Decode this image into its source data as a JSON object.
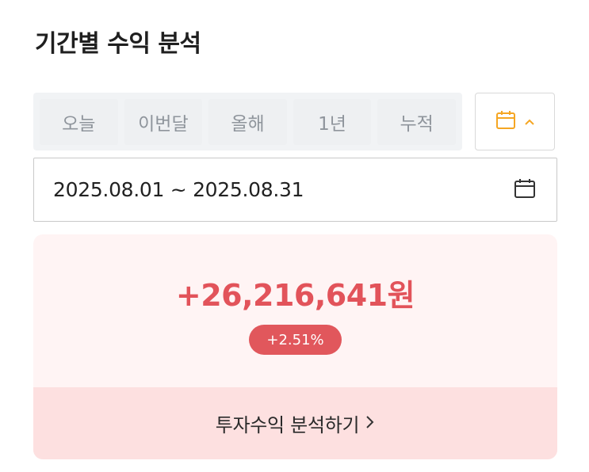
{
  "header": {
    "title": "기간별 수익 분석"
  },
  "period_tabs": [
    {
      "label": "오늘"
    },
    {
      "label": "이번달"
    },
    {
      "label": "올해"
    },
    {
      "label": "1년"
    },
    {
      "label": "누적"
    }
  ],
  "calendar_toggle": {
    "icon": "calendar-icon",
    "state_icon": "chevron-up-icon",
    "accent_color": "#f5a623"
  },
  "date_range": {
    "value": "2025.08.01 ~ 2025.08.31",
    "icon": "calendar-icon"
  },
  "summary": {
    "profit_amount": "+26,216,641원",
    "profit_rate": "+2.51%",
    "profit_color": "#e2535a",
    "link_label": "투자수익 분석하기",
    "link_icon": "chevron-right-icon"
  }
}
